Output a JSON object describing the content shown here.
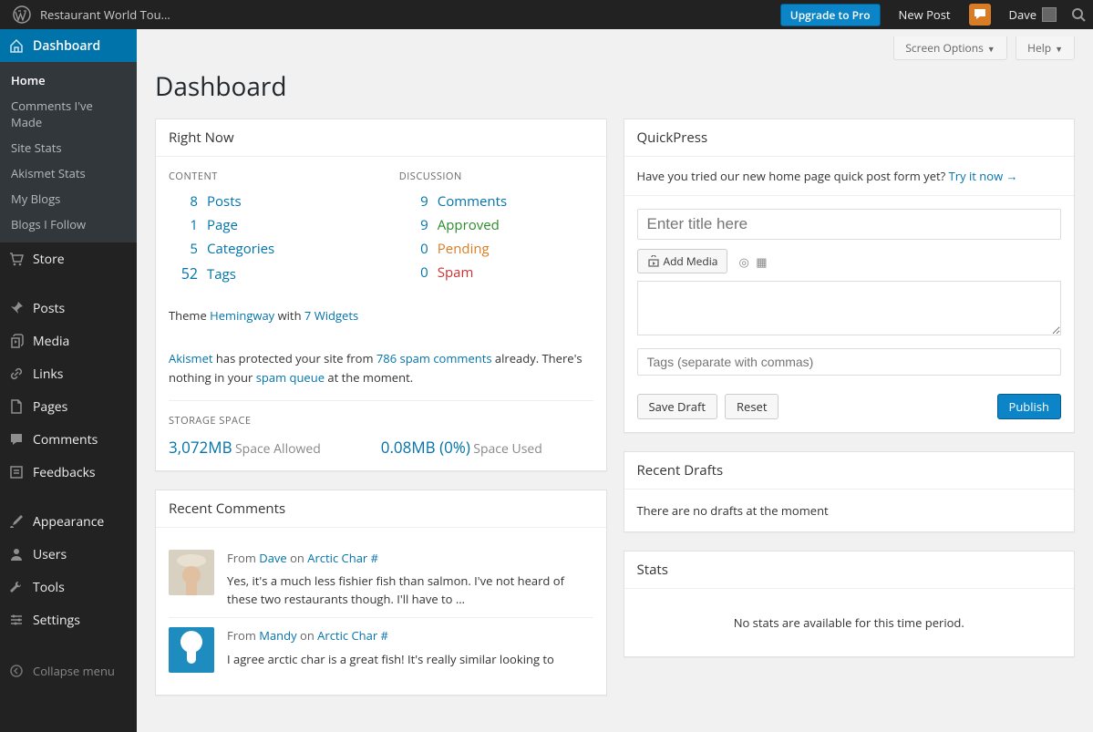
{
  "adminbar": {
    "site_title": "Restaurant World Tou…",
    "upgrade": "Upgrade to Pro",
    "new_post": "New Post",
    "user": "Dave"
  },
  "topright": {
    "screen_options": "Screen Options",
    "help": "Help"
  },
  "page_title": "Dashboard",
  "menu": {
    "dashboard": "Dashboard",
    "sub": {
      "home": "Home",
      "comments_made": "Comments I've Made",
      "site_stats": "Site Stats",
      "akismet_stats": "Akismet Stats",
      "my_blogs": "My Blogs",
      "blogs_follow": "Blogs I Follow"
    },
    "store": "Store",
    "posts": "Posts",
    "media": "Media",
    "links": "Links",
    "pages": "Pages",
    "comments": "Comments",
    "feedbacks": "Feedbacks",
    "appearance": "Appearance",
    "users": "Users",
    "tools": "Tools",
    "settings": "Settings",
    "collapse": "Collapse menu"
  },
  "right_now": {
    "title": "Right Now",
    "content_head": "CONTENT",
    "discussion_head": "DISCUSSION",
    "content": {
      "posts_n": "8",
      "posts_l": "Posts",
      "pages_n": "1",
      "pages_l": "Page",
      "cats_n": "5",
      "cats_l": "Categories",
      "tags_n": "52",
      "tags_l": "Tags"
    },
    "discussion": {
      "comments_n": "9",
      "comments_l": "Comments",
      "approved_n": "9",
      "approved_l": "Approved",
      "pending_n": "0",
      "pending_l": "Pending",
      "spam_n": "0",
      "spam_l": "Spam"
    },
    "themeline_prefix": "Theme ",
    "theme": "Hemingway",
    "themeline_mid": " with ",
    "widgets": "7 Widgets",
    "akismet_name": "Akismet",
    "akismet_mid": " has protected your site from ",
    "akismet_count": "786 spam comments",
    "akismet_end": " already. There's nothing in your ",
    "akismet_queue": "spam queue",
    "akismet_tail": " at the moment.",
    "storage_head": "STORAGE SPACE",
    "allowed_val": "3,072MB",
    "allowed_txt": "Space Allowed",
    "used_val": "0.08MB (0%)",
    "used_txt": "Space Used"
  },
  "recent_comments": {
    "title": "Recent Comments",
    "items": [
      {
        "from_prefix": "From ",
        "author": "Dave",
        "on": " on ",
        "post": "Arctic Char #",
        "text": "Yes, it's a much less fishier fish than salmon. I've not heard of these two restaurants though. I'll have to …",
        "avatar_type": "photo"
      },
      {
        "from_prefix": "From ",
        "author": "Mandy",
        "on": " on ",
        "post": "Arctic Char #",
        "text": "I agree arctic char is a great fish! It's really similar looking to",
        "avatar_type": "gravatar"
      }
    ]
  },
  "quickpress": {
    "title": "QuickPress",
    "prompt": "Have you tried our new home page quick post form yet? ",
    "try_it": "Try it now →",
    "title_placeholder": "Enter title here",
    "add_media": "Add Media",
    "tags_placeholder": "Tags (separate with commas)",
    "save_draft": "Save Draft",
    "reset": "Reset",
    "publish": "Publish"
  },
  "recent_drafts": {
    "title": "Recent Drafts",
    "empty": "There are no drafts at the moment"
  },
  "stats": {
    "title": "Stats",
    "empty": "No stats are available for this time period."
  }
}
